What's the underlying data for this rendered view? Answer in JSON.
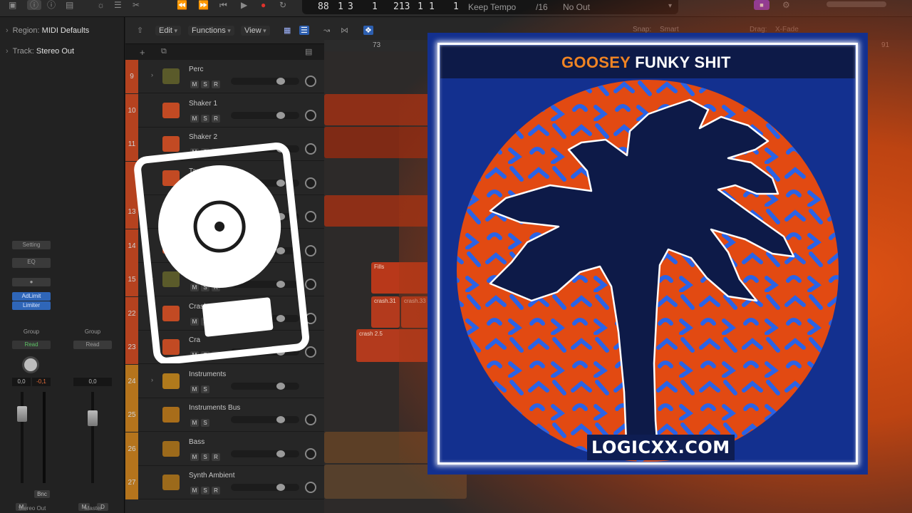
{
  "lcd": {
    "bar": "88",
    "beat": "1",
    "division": "3",
    "tick": "1",
    "end_bar": "213",
    "end_beat": "1",
    "end_division": "1",
    "end_tick": "1",
    "mode": "Keep Tempo",
    "signature": "/16",
    "output": "No Out"
  },
  "inspector": {
    "region_label": "Region:",
    "region_value": "MIDI Defaults",
    "track_label": "Track:",
    "track_value": "Stereo Out",
    "left_strip": {
      "setting": "Setting",
      "eq": "EQ",
      "inserts": [
        "AdLimit",
        "Limiter"
      ],
      "group": "Group",
      "automation": "Read",
      "vol": "0,0",
      "pan": "-0,1",
      "bounce": "Bnc",
      "mute": "M",
      "name": "Stereo Out"
    },
    "right_strip": {
      "group": "Group",
      "automation": "Read",
      "vol": "0,0",
      "mute": "M",
      "dim": "D",
      "name": "Master"
    }
  },
  "toolbar": {
    "menus": [
      "Edit",
      "Functions",
      "View"
    ],
    "snap_label": "Snap:",
    "snap_value": "Smart",
    "drag_label": "Drag:",
    "drag_value": "X-Fade"
  },
  "ruler": [
    "73",
    "91"
  ],
  "tracks": [
    {
      "num": "9",
      "name": "Perc",
      "kind": "folder",
      "buttons": [
        "M",
        "S",
        "R"
      ]
    },
    {
      "num": "10",
      "name": "Shaker 1",
      "kind": "drum",
      "buttons": [
        "M",
        "S",
        "R"
      ]
    },
    {
      "num": "11",
      "name": "Shaker 2",
      "kind": "drum",
      "buttons": [
        "M",
        "S",
        "R"
      ]
    },
    {
      "num": "",
      "name": "Tam",
      "kind": "drum",
      "buttons": [
        "M",
        "S",
        "R"
      ]
    },
    {
      "num": "13",
      "name": "",
      "kind": "drum",
      "buttons": [
        "M",
        "S",
        "R"
      ]
    },
    {
      "num": "14",
      "name": "",
      "kind": "drum",
      "buttons": [
        "M",
        "S",
        "R"
      ]
    },
    {
      "num": "15",
      "name": "",
      "kind": "folder",
      "buttons": [
        "M",
        "S",
        "R"
      ]
    },
    {
      "num": "22",
      "name": "Crash",
      "kind": "drum",
      "buttons": [
        "M",
        "S",
        "R"
      ]
    },
    {
      "num": "23",
      "name": "Cra",
      "kind": "drum",
      "buttons": [
        "M",
        "S",
        "R"
      ]
    },
    {
      "num": "24",
      "name": "Instruments",
      "kind": "stack",
      "buttons": [
        "M",
        "S"
      ]
    },
    {
      "num": "25",
      "name": "Instruments Bus",
      "kind": "audio",
      "buttons": [
        "M",
        "S"
      ]
    },
    {
      "num": "26",
      "name": "Bass",
      "kind": "synth",
      "buttons": [
        "M",
        "S",
        "R"
      ]
    },
    {
      "num": "27",
      "name": "Synth Ambient",
      "kind": "synth",
      "buttons": [
        "M",
        "S",
        "R"
      ]
    }
  ],
  "regions": [
    {
      "label": "Fills",
      "color": "#b8381a"
    },
    {
      "label": "crash.31",
      "color": "#b33a1d"
    },
    {
      "label": "crash.33",
      "color": "#b33a1d"
    },
    {
      "label": "crash 2.5",
      "color": "#b33a1d"
    }
  ],
  "cover": {
    "artist": "GOOSEY",
    "track": "FUNKY SHIT",
    "url": "LOGICXX.COM",
    "colors": {
      "background": "#13308f",
      "circle": "#e24a12",
      "pattern": "#2a63e6",
      "palm": "#0d1a48",
      "artist": "#f08423"
    }
  },
  "logo": {
    "icon": "logic-pro-vinyl-icon"
  }
}
